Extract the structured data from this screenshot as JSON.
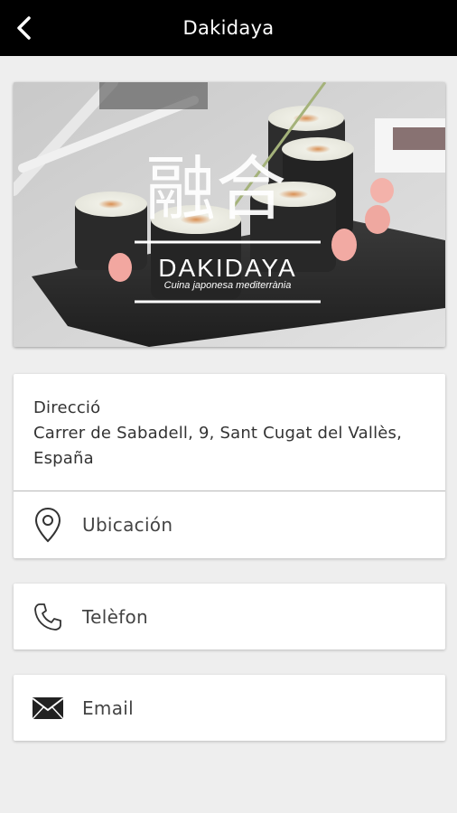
{
  "appbar": {
    "title": "Dakidaya",
    "back_icon": "chevron-left-icon"
  },
  "hero": {
    "kanji": "融合",
    "brand": "DAKIDAYA",
    "tagline": "Cuina japonesa mediterrània"
  },
  "address": {
    "label": "Direcció",
    "value_line1": "Carrer de Sabadell, 9, Sant Cugat del Vallès,",
    "value_line2": "España"
  },
  "location": {
    "label": "Ubicación",
    "icon": "map-pin-icon"
  },
  "phone": {
    "label": "Telèfon",
    "icon": "phone-icon"
  },
  "email": {
    "label": "Email",
    "icon": "envelope-icon"
  },
  "colors": {
    "appbar": "#000000",
    "background": "#eeeeee",
    "card": "#ffffff",
    "text": "#333333"
  }
}
